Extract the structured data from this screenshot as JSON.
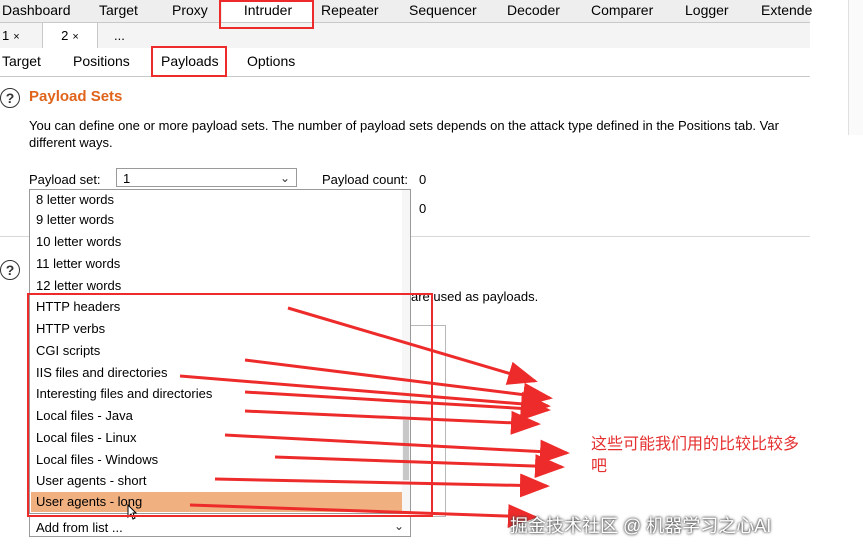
{
  "main_tabs": [
    "Dashboard",
    "Target",
    "Proxy",
    "Intruder",
    "Repeater",
    "Sequencer",
    "Decoder",
    "Comparer",
    "Logger",
    "Extende"
  ],
  "sub_tabs": [
    {
      "label": "1",
      "close": "×"
    },
    {
      "label": "2",
      "close": "×"
    },
    {
      "label": "..."
    }
  ],
  "intruder_tabs": [
    "Target",
    "Positions",
    "Payloads",
    "Options"
  ],
  "payload_sets": {
    "title": "Payload Sets",
    "description_line1": "You can define one or more payload sets. The number of payload sets depends on the attack type defined in the Positions tab. Var",
    "description_line2": "different ways.",
    "set_label": "Payload set:",
    "set_value": "1",
    "count_label": "Payload count:",
    "count_value": "0",
    "second_value": "0"
  },
  "payload_options": {
    "partial_text": "are used as payloads."
  },
  "dropdown_items": [
    "8 letter words",
    "9 letter words",
    "10 letter words",
    "11 letter words",
    "12 letter words",
    "HTTP headers",
    "HTTP verbs",
    "CGI scripts",
    "IIS files and directories",
    "Interesting files and directories",
    "Local files - Java",
    "Local files - Linux",
    "Local files - Windows",
    "User agents - short",
    "User agents - long"
  ],
  "selected_item_index": 14,
  "add_from_list": "Add from list ...",
  "annotation": "这些可能我们用的比较比较多吧",
  "watermark": "掘金技术社区 @ 机器学习之心AI",
  "colors": {
    "accent": "#e0641b",
    "annotation_red": "#ee2b2b",
    "selection": "#f0b07f"
  }
}
